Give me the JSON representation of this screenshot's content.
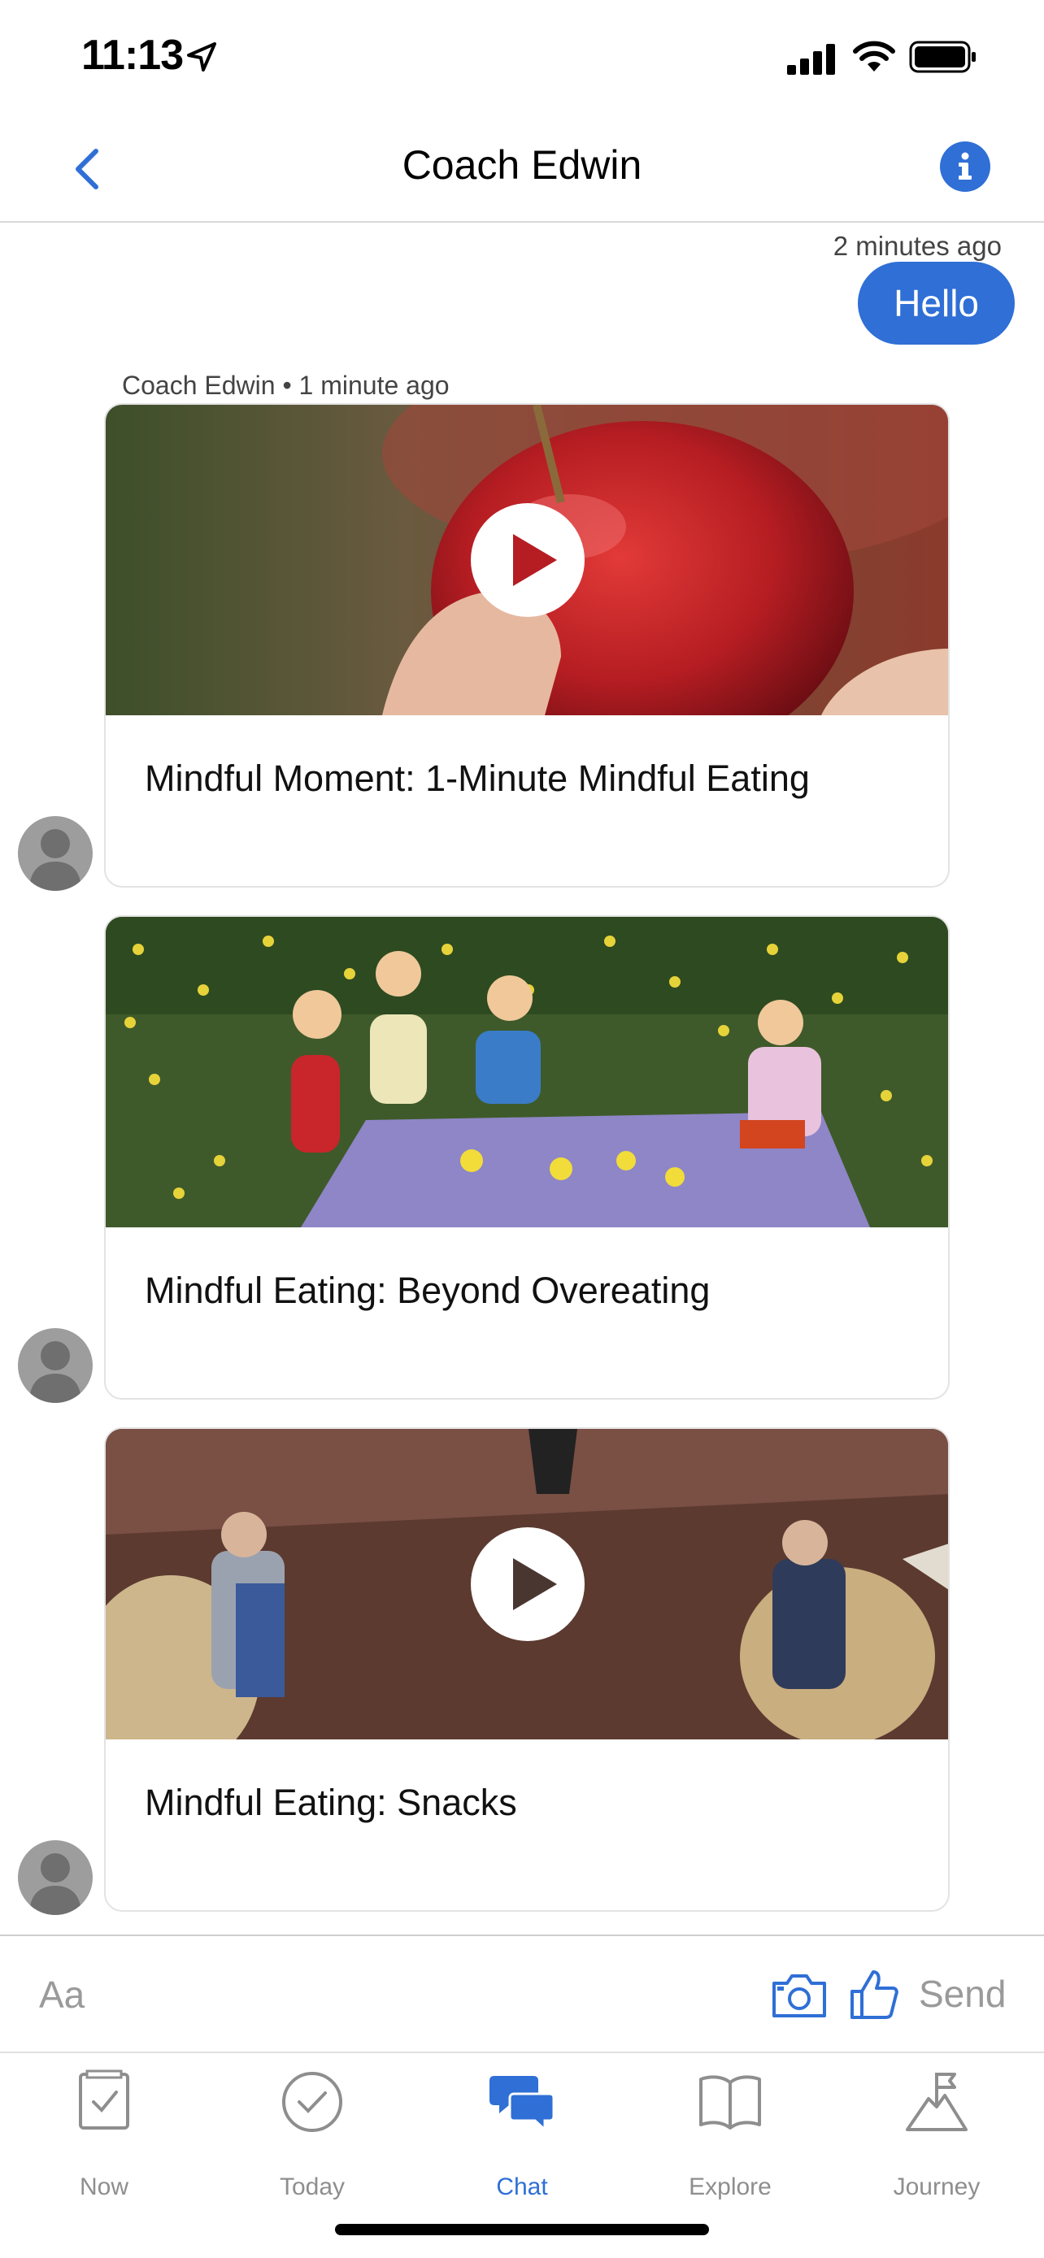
{
  "status_bar": {
    "time": "11:13",
    "icons": [
      "location-arrow-icon",
      "cellular-signal-icon",
      "wifi-icon",
      "battery-icon"
    ]
  },
  "header": {
    "title": "Coach Edwin",
    "back_icon": "chevron-left-icon",
    "info_icon": "info-icon"
  },
  "conversation": {
    "sent_message": {
      "time": "2 minutes ago",
      "text": "Hello"
    },
    "coach_meta": "Coach Edwin • 1 minute ago",
    "cards": [
      {
        "title": "Mindful Moment: 1-Minute Mindful Eating",
        "has_play": true,
        "thumbnail": "apple"
      },
      {
        "title": "Mindful Eating: Beyond Overeating",
        "has_play": false,
        "thumbnail": "picnic"
      },
      {
        "title": "Mindful Eating: Snacks",
        "has_play": true,
        "thumbnail": "chocolate"
      }
    ]
  },
  "composer": {
    "placeholder": "Aa",
    "send_label": "Send",
    "icons": [
      "camera-icon",
      "thumbs-up-icon"
    ]
  },
  "tab_bar": {
    "tabs": [
      {
        "label": "Now",
        "icon": "now-icon",
        "active": false
      },
      {
        "label": "Today",
        "icon": "today-check-icon",
        "active": false
      },
      {
        "label": "Chat",
        "icon": "chat-bubbles-icon",
        "active": true
      },
      {
        "label": "Explore",
        "icon": "open-book-icon",
        "active": false
      },
      {
        "label": "Journey",
        "icon": "mountain-flag-icon",
        "active": false
      }
    ]
  },
  "colors": {
    "accent": "#2f6fd6",
    "inactive": "#8e8e8e",
    "divider": "#d9d9d9"
  }
}
